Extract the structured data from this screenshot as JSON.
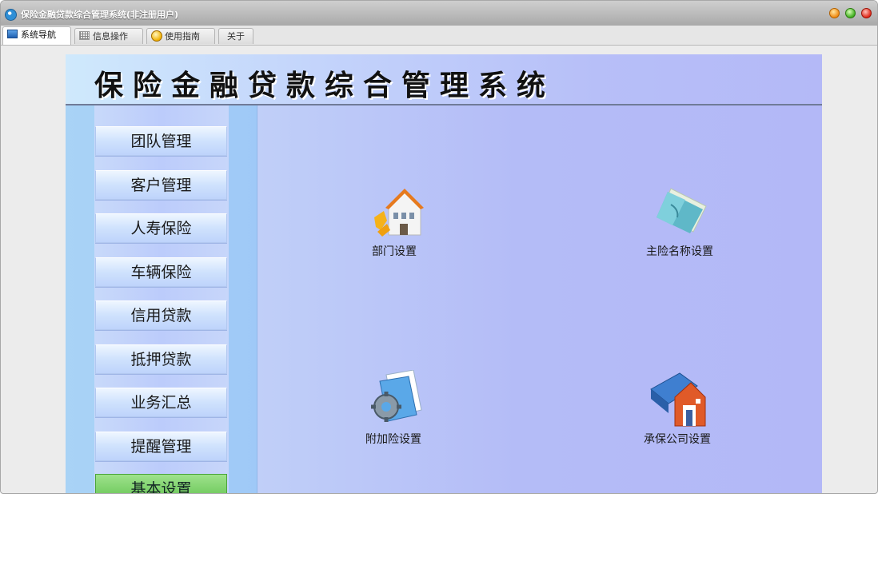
{
  "window": {
    "title": "保险金融贷款综合管理系统(非注册用户)"
  },
  "tabs": [
    {
      "label": "系统导航",
      "icon": "monitor-icon",
      "active": true
    },
    {
      "label": "信息操作",
      "icon": "grid-icon",
      "active": false
    },
    {
      "label": "使用指南",
      "icon": "help-icon",
      "active": false
    },
    {
      "label": "关于",
      "icon": "",
      "active": false
    }
  ],
  "banner": {
    "title": "保险金融贷款综合管理系统"
  },
  "sidebar": {
    "items": [
      {
        "label": "团队管理"
      },
      {
        "label": "客户管理"
      },
      {
        "label": "人寿保险"
      },
      {
        "label": "车辆保险"
      },
      {
        "label": "信用贷款"
      },
      {
        "label": "抵押贷款"
      },
      {
        "label": "业务汇总"
      },
      {
        "label": "提醒管理"
      },
      {
        "label": "基本设置",
        "active": true
      }
    ]
  },
  "main": {
    "items": [
      {
        "label": "部门设置",
        "icon": "building-icon"
      },
      {
        "label": "主险名称设置",
        "icon": "folder-icon"
      },
      {
        "label": "附加险设置",
        "icon": "gear-document-icon"
      },
      {
        "label": "承保公司设置",
        "icon": "company-book-icon"
      }
    ]
  },
  "colors": {
    "accent_active": "#62c24f",
    "panel": "#b4bcf7",
    "sidebar": "#a9d3f6"
  }
}
